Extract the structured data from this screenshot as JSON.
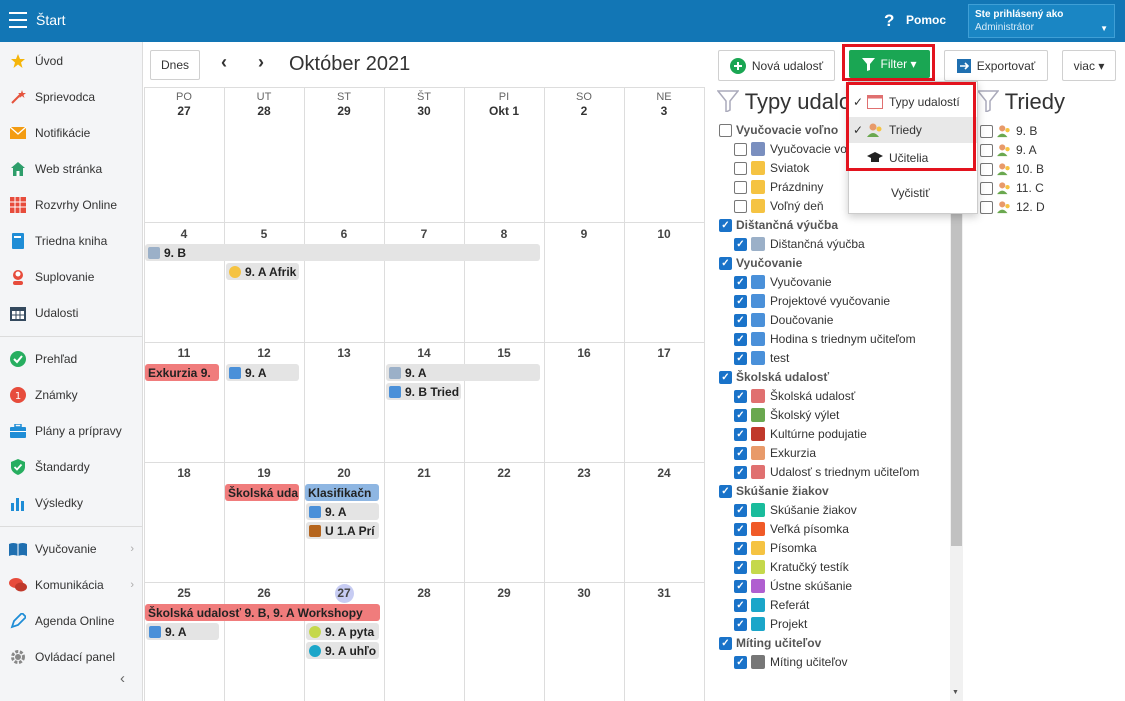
{
  "topbar": {
    "title": "Štart",
    "help": "Pomoc",
    "user_line1": "Ste prihlásený ako",
    "user_line2": "Administrátor"
  },
  "sidebar": {
    "items": [
      {
        "label": "Úvod",
        "icon": "star-icon"
      },
      {
        "label": "Sprievodca",
        "icon": "magic-wand-icon"
      },
      {
        "label": "Notifikácie",
        "icon": "envelope-icon"
      },
      {
        "label": "Web stránka",
        "icon": "house-icon"
      },
      {
        "label": "Rozvrhy Online",
        "icon": "timetable-icon"
      },
      {
        "label": "Triedna kniha",
        "icon": "book-icon"
      },
      {
        "label": "Suplovanie",
        "icon": "person-icon"
      },
      {
        "label": "Udalosti",
        "icon": "calendar-icon"
      },
      {
        "label": "Prehľad",
        "icon": "check-circle-icon"
      },
      {
        "label": "Známky",
        "icon": "grade-icon"
      },
      {
        "label": "Plány a prípravy",
        "icon": "briefcase-icon"
      },
      {
        "label": "Štandardy",
        "icon": "shield-check-icon"
      },
      {
        "label": "Výsledky",
        "icon": "bar-chart-icon"
      },
      {
        "label": "Vyučovanie",
        "icon": "open-book-icon"
      },
      {
        "label": "Komunikácia",
        "icon": "chat-icon"
      },
      {
        "label": "Agenda Online",
        "icon": "pen-icon"
      },
      {
        "label": "Ovládací panel",
        "icon": "gear-icon"
      }
    ]
  },
  "toolbar": {
    "today": "Dnes",
    "month": "Október 2021",
    "new_event": "Nová udalosť",
    "filter": "Filter ▾",
    "export": "Exportovať",
    "more": "viac ▾"
  },
  "calendar": {
    "weekdays": [
      {
        "abbr": "PO",
        "date": "27"
      },
      {
        "abbr": "UT",
        "date": "28"
      },
      {
        "abbr": "ST",
        "date": "29"
      },
      {
        "abbr": "ŠT",
        "date": "30"
      },
      {
        "abbr": "PI",
        "date": "Okt 1"
      },
      {
        "abbr": "SO",
        "date": "2"
      },
      {
        "abbr": "NE",
        "date": "3"
      }
    ],
    "weeks": [
      [
        "4",
        "5",
        "6",
        "7",
        "8",
        "9",
        "10"
      ],
      [
        "11",
        "12",
        "13",
        "14",
        "15",
        "16",
        "17"
      ],
      [
        "18",
        "19",
        "20",
        "21",
        "22",
        "23",
        "24"
      ],
      [
        "25",
        "26",
        "27",
        "28",
        "29",
        "30",
        "31"
      ]
    ],
    "events": {
      "w1_a": "9. B",
      "w1_b": "9. A Afrik",
      "w2_a": "Exkurzia 9.",
      "w2_b": "9. A",
      "w2_c": "9. A",
      "w2_d": "9. B Tried",
      "w3_a": "Školská uda",
      "w3_b": "Klasifikačn",
      "w3_c": "9. A",
      "w3_d": "U 1.A Prí",
      "w4_a": "Školská udalosť 9. B, 9. A Workshopy",
      "w4_b": "9. A",
      "w4_c": "9. A pyta",
      "w4_d": "9. A uhľo"
    }
  },
  "event_types": {
    "title": "Typy udalo",
    "groups": [
      {
        "label": "Vyučovacie voľno",
        "checked": false,
        "items": [
          {
            "label": "Vyučovacie vo",
            "checked": false,
            "color": "#7a8fbf"
          },
          {
            "label": "Sviatok",
            "checked": false,
            "color": "#f5c342"
          },
          {
            "label": "Prázdniny",
            "checked": false,
            "color": "#f5c342"
          },
          {
            "label": "Voľný deň",
            "checked": false,
            "color": "#f5c342"
          }
        ]
      },
      {
        "label": "Dištančná výučba",
        "checked": true,
        "items": [
          {
            "label": "Dištančná výučba",
            "checked": true,
            "color": "#9bb0c8"
          }
        ]
      },
      {
        "label": "Vyučovanie",
        "checked": true,
        "items": [
          {
            "label": "Vyučovanie",
            "checked": true,
            "color": "#4a90d9"
          },
          {
            "label": "Projektové vyučovanie",
            "checked": true,
            "color": "#4a90d9"
          },
          {
            "label": "Doučovanie",
            "checked": true,
            "color": "#4a90d9"
          },
          {
            "label": "Hodina s triednym učiteľom",
            "checked": true,
            "color": "#4a90d9"
          },
          {
            "label": "test",
            "checked": true,
            "color": "#4a90d9"
          }
        ]
      },
      {
        "label": "Školská udalosť",
        "checked": true,
        "items": [
          {
            "label": "Školská udalosť",
            "checked": true,
            "color": "#e07070"
          },
          {
            "label": "Školský výlet",
            "checked": true,
            "color": "#6aa84f"
          },
          {
            "label": "Kultúrne podujatie",
            "checked": true,
            "color": "#c0392b"
          },
          {
            "label": "Exkurzia",
            "checked": true,
            "color": "#e89a6a"
          },
          {
            "label": "Udalosť s triednym učiteľom",
            "checked": true,
            "color": "#e07070"
          }
        ]
      },
      {
        "label": "Skúšanie žiakov",
        "checked": true,
        "items": [
          {
            "label": "Skúšanie žiakov",
            "checked": true,
            "color": "#1abc9c"
          },
          {
            "label": "Veľká písomka",
            "checked": true,
            "color": "#f05a28"
          },
          {
            "label": "Písomka",
            "checked": true,
            "color": "#f5c342"
          },
          {
            "label": "Kratučký testík",
            "checked": true,
            "color": "#c5d84b"
          },
          {
            "label": "Ústne skúšanie",
            "checked": true,
            "color": "#b05fd0"
          },
          {
            "label": "Referát",
            "checked": true,
            "color": "#1ba6c9"
          },
          {
            "label": "Projekt",
            "checked": true,
            "color": "#1ba6c9"
          }
        ]
      },
      {
        "label": "Míting učiteľov",
        "checked": true,
        "items": [
          {
            "label": "Míting učiteľov",
            "checked": true,
            "color": "#777777"
          }
        ]
      }
    ]
  },
  "classes": {
    "title": "Triedy",
    "items": [
      "9. B",
      "9. A",
      "10. B",
      "11. C",
      "12. D"
    ]
  },
  "filter_dropdown": {
    "items": [
      {
        "label": "Typy udalostí",
        "checked": true
      },
      {
        "label": "Triedy",
        "checked": true
      },
      {
        "label": "Učitelia",
        "checked": false
      }
    ],
    "clear": "Vyčistiť"
  }
}
